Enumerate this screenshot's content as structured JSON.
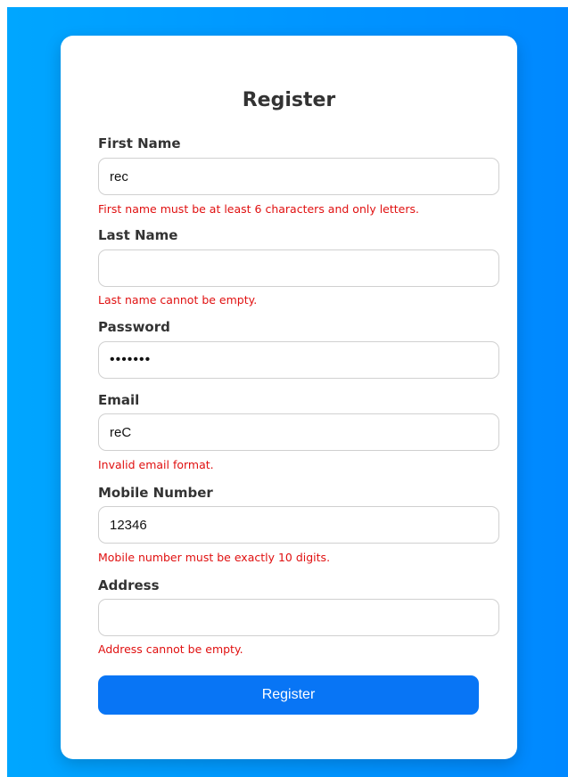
{
  "form": {
    "title": "Register",
    "submit_label": "Register",
    "fields": {
      "first_name": {
        "label": "First Name",
        "value": "rec",
        "error": "First name must be at least 6 characters and only letters."
      },
      "last_name": {
        "label": "Last Name",
        "value": "",
        "error": "Last name cannot be empty."
      },
      "password": {
        "label": "Password",
        "value": "•••••••"
      },
      "email": {
        "label": "Email",
        "value": "reC",
        "error": "Invalid email format."
      },
      "mobile": {
        "label": "Mobile Number",
        "value": "12346",
        "error": "Mobile number must be exactly 10 digits."
      },
      "address": {
        "label": "Address",
        "value": "",
        "error": "Address cannot be empty."
      }
    }
  },
  "colors": {
    "background_gradient_start": "#00a6ff",
    "background_gradient_end": "#0088ff",
    "button": "#0875f5",
    "error": "#e01010"
  }
}
